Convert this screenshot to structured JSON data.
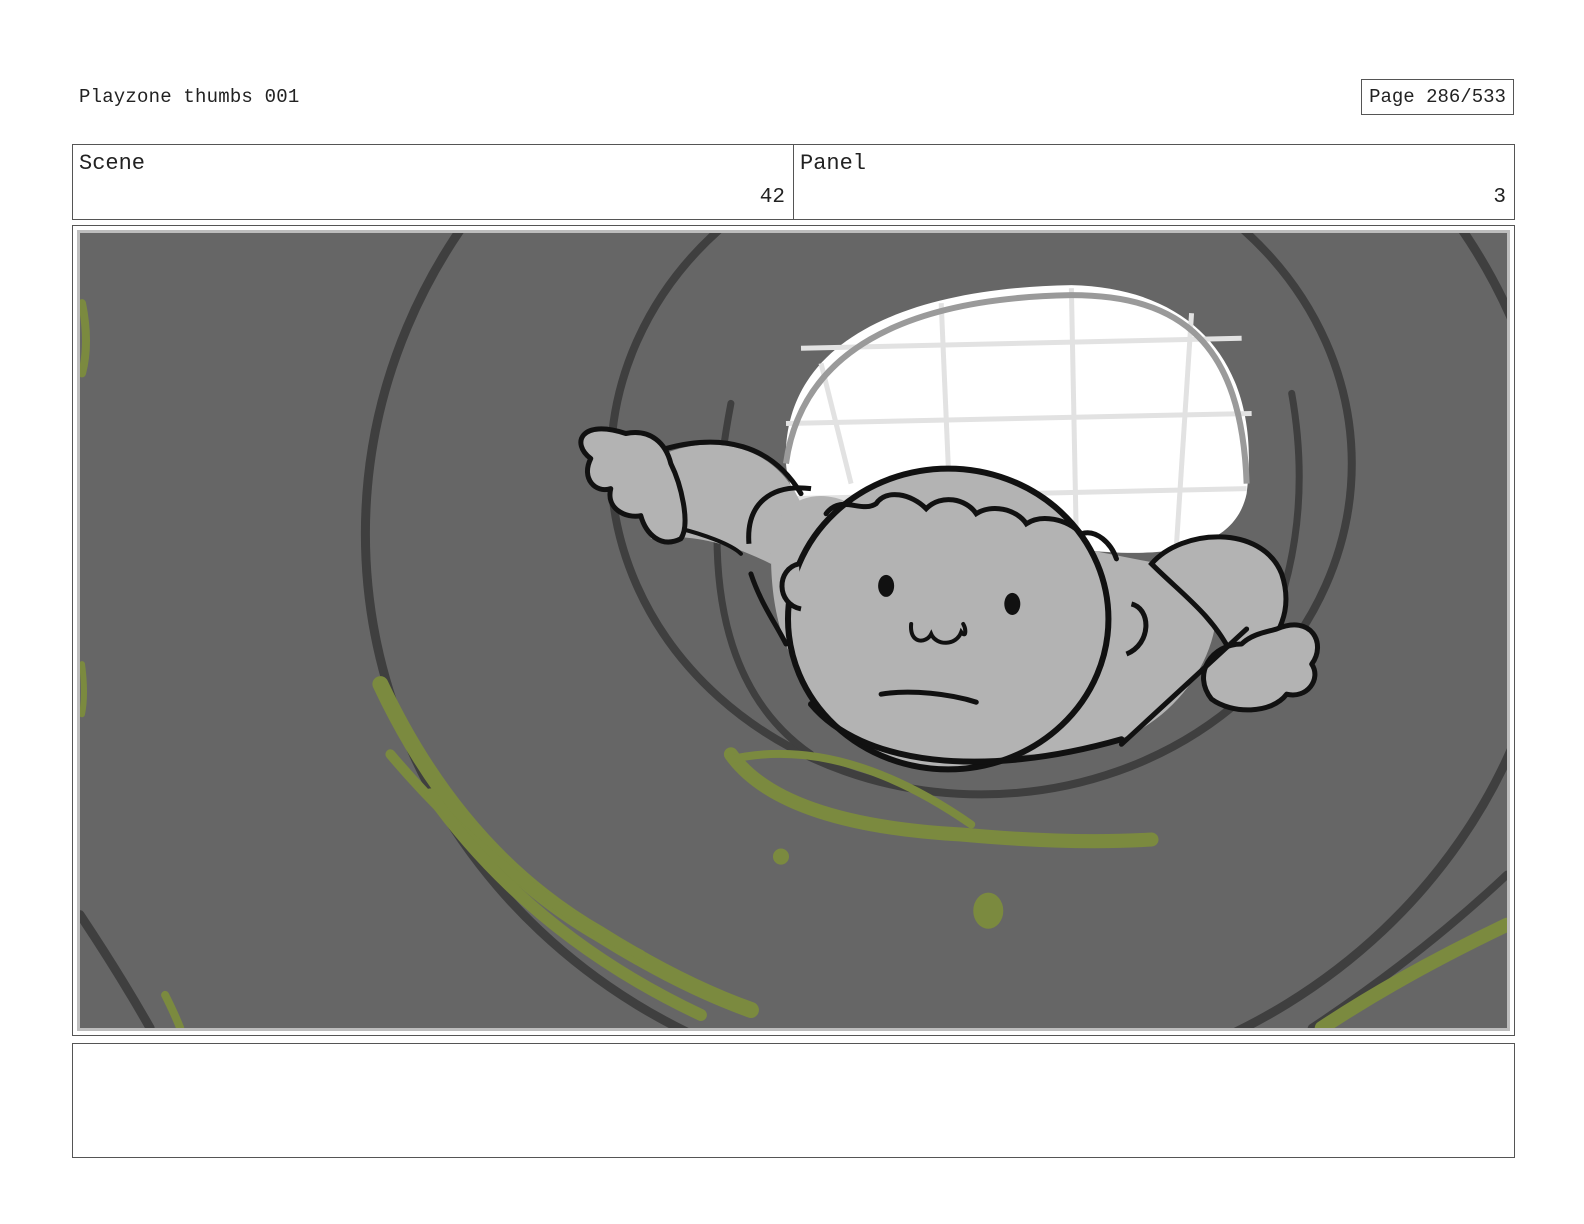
{
  "header": {
    "title": "Playzone thumbs 001",
    "page": "Page 286/533"
  },
  "meta": {
    "scene_label": "Scene",
    "scene_value": "42",
    "panel_label": "Panel",
    "panel_value": "3"
  },
  "panel_image": {
    "description_icon": "storyboard-sketch-icon",
    "colors": {
      "background": "#666666",
      "character": "#b3b3b3",
      "window": "#ffffff",
      "slime": "#7b8a3f",
      "ink": "#111111"
    }
  },
  "notes": {
    "text": ""
  }
}
